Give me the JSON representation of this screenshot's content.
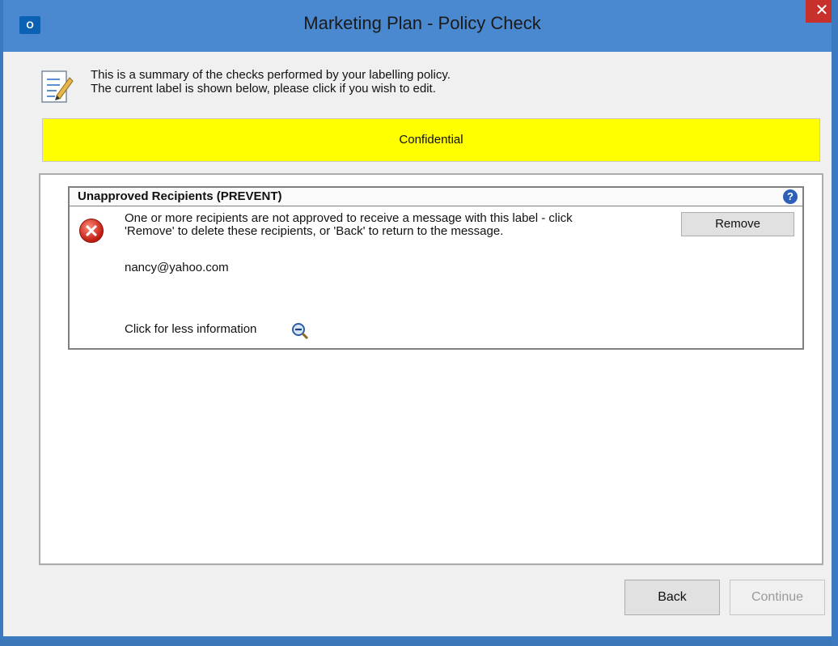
{
  "window": {
    "title": "Marketing Plan - Policy Check",
    "app_icon_text": "O",
    "close_label": "✕"
  },
  "intro": {
    "line1": "This is a summary of the checks performed by your labelling policy.",
    "line2": "The current label is shown below, please click if you wish to edit."
  },
  "label": {
    "text": "Confidential",
    "color": "#ffff00"
  },
  "check": {
    "title": "Unapproved Recipients (PREVENT)",
    "message_line1": "One or more recipients are not approved to receive a message with this label - click",
    "message_line2": "'Remove' to delete these recipients, or 'Back' to return to the message.",
    "recipient": "nancy@yahoo.com",
    "less_info": "Click for less information",
    "remove_label": "Remove",
    "help_icon": "?",
    "error_icon": "✕"
  },
  "footer": {
    "back_label": "Back",
    "continue_label": "Continue"
  },
  "colors": {
    "titlebar": "#4a89d0",
    "close": "#c7302b",
    "error": "#c01a10"
  }
}
